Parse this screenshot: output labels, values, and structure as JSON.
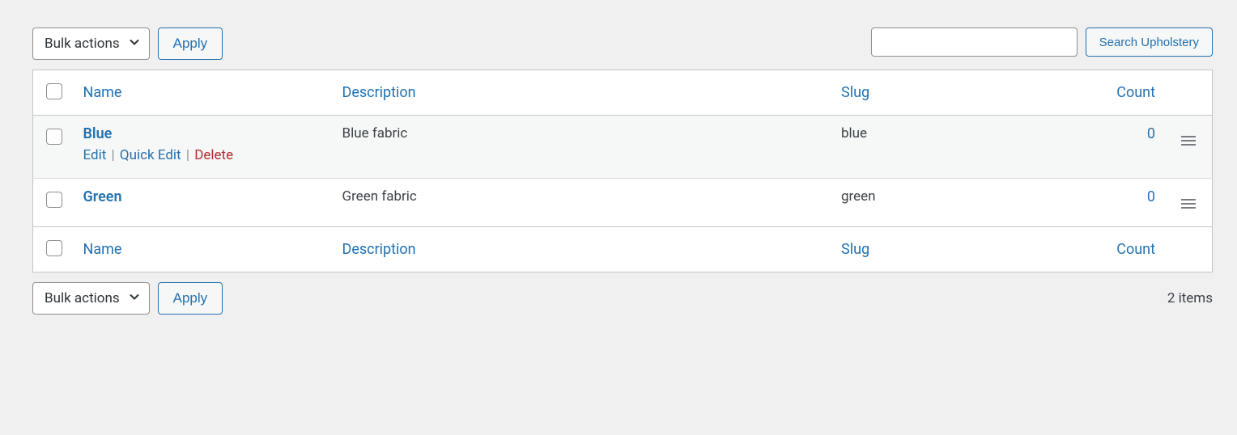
{
  "search": {
    "placeholder": "",
    "button": "Search Upholstery"
  },
  "bulk": {
    "label": "Bulk actions",
    "apply": "Apply"
  },
  "pagination": {
    "items_label": "2 items"
  },
  "columns": {
    "name": "Name",
    "description": "Description",
    "slug": "Slug",
    "count": "Count"
  },
  "rows": [
    {
      "name": "Blue",
      "description": "Blue fabric",
      "slug": "blue",
      "count": "0",
      "hovered": true,
      "actions": {
        "edit": "Edit",
        "quick_edit": "Quick Edit",
        "delete": "Delete"
      }
    },
    {
      "name": "Green",
      "description": "Green fabric",
      "slug": "green",
      "count": "0",
      "hovered": false
    }
  ]
}
